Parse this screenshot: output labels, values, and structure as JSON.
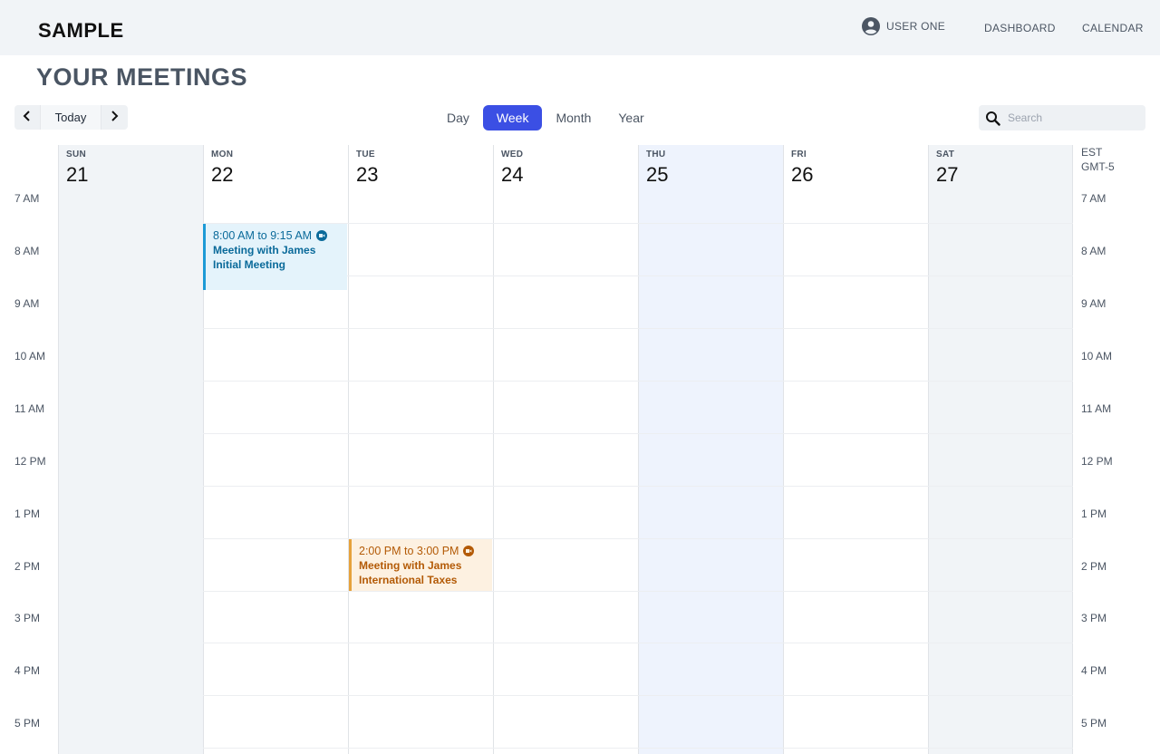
{
  "header": {
    "logo": "SAMPLE",
    "user_name": "USER ONE",
    "nav": [
      "DASHBOARD",
      "CALENDAR"
    ]
  },
  "page_title": "YOUR MEETINGS",
  "toolbar": {
    "today_label": "Today",
    "views": [
      "Day",
      "Week",
      "Month",
      "Year"
    ],
    "active_view": "Week",
    "search_placeholder": "Search"
  },
  "calendar": {
    "days": [
      {
        "name": "SUN",
        "num": "21"
      },
      {
        "name": "MON",
        "num": "22"
      },
      {
        "name": "TUE",
        "num": "23"
      },
      {
        "name": "WED",
        "num": "24"
      },
      {
        "name": "THU",
        "num": "25"
      },
      {
        "name": "FRI",
        "num": "26"
      },
      {
        "name": "SAT",
        "num": "27"
      }
    ],
    "timezone": [
      "EST",
      "GMT-5"
    ],
    "hours": [
      "7 AM",
      "8 AM",
      "9 AM",
      "10 AM",
      "11 AM",
      "12 PM",
      "1 PM",
      "2 PM",
      "3 PM",
      "4 PM",
      "5 PM"
    ],
    "events": [
      {
        "day": "MON",
        "time": "8:00 AM to 9:15 AM",
        "title": "Meeting with James",
        "subtitle": "Initial Meeting",
        "color": "#1c9ad6"
      },
      {
        "day": "TUE",
        "time": "2:00 PM to 3:00 PM",
        "title": "Meeting with James",
        "subtitle": "International Taxes",
        "color": "#e6a23c"
      }
    ]
  },
  "colors": {
    "accent": "#3b4fe4",
    "weekend_bg": "#f1f4f7",
    "today_bg": "#eef3fd"
  }
}
